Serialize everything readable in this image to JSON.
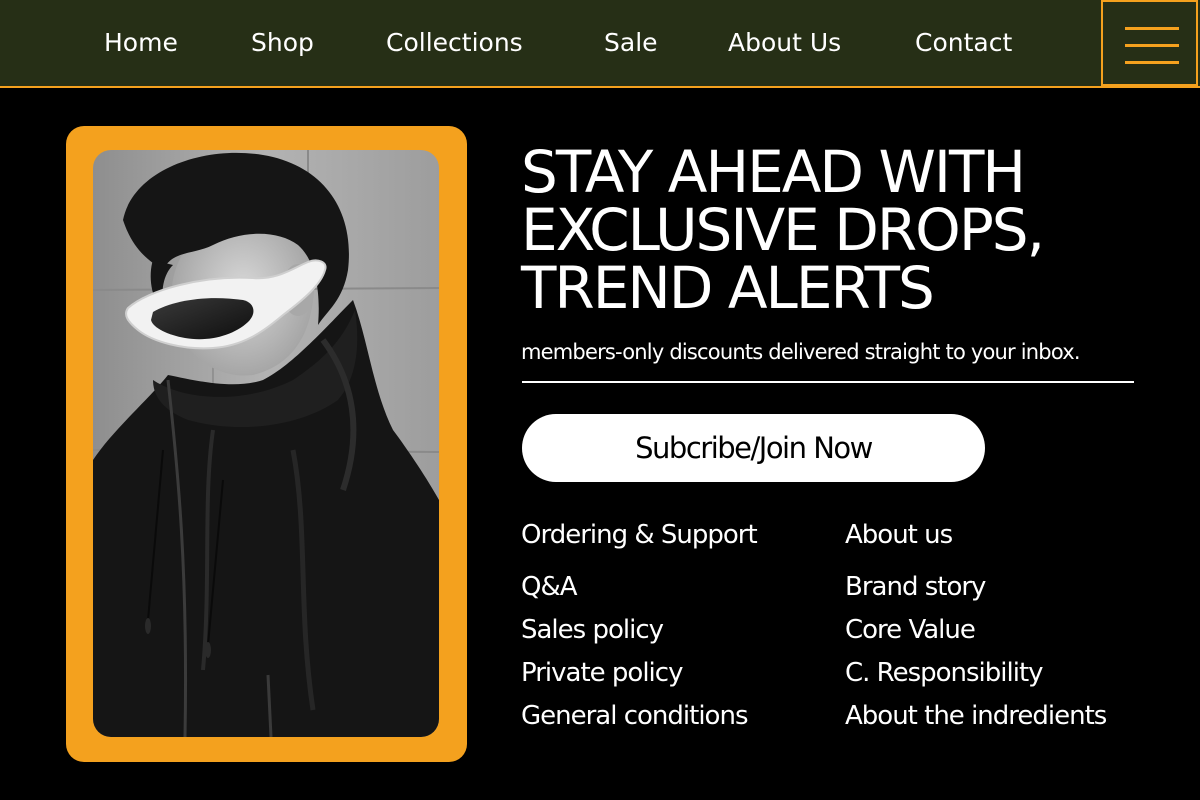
{
  "nav": {
    "items": [
      {
        "label": "Home"
      },
      {
        "label": "Shop"
      },
      {
        "label": "Collections"
      },
      {
        "label": "Sale"
      },
      {
        "label": "About Us"
      },
      {
        "label": "Contact"
      }
    ],
    "menu_icon": "hamburger-menu-icon"
  },
  "colors": {
    "accent": "#f4a11e",
    "nav_bg": "#262f16",
    "page_bg": "#000000",
    "text": "#ffffff"
  },
  "hero": {
    "headline_lines": [
      "STAY AHEAD WITH",
      "EXCLUSIVE DROPS,",
      "TREND ALERTS"
    ],
    "subtext": "members-only discounts delivered straight to your inbox.",
    "cta_label": "Subcribe/Join Now"
  },
  "footer_columns": [
    {
      "title": "Ordering & Support",
      "links": [
        "Q&A",
        "Sales policy",
        "Private policy",
        "General conditions"
      ]
    },
    {
      "title": "About us",
      "links": [
        "Brand story",
        "Core Value",
        "C. Responsibility",
        "About the indredients"
      ]
    }
  ]
}
